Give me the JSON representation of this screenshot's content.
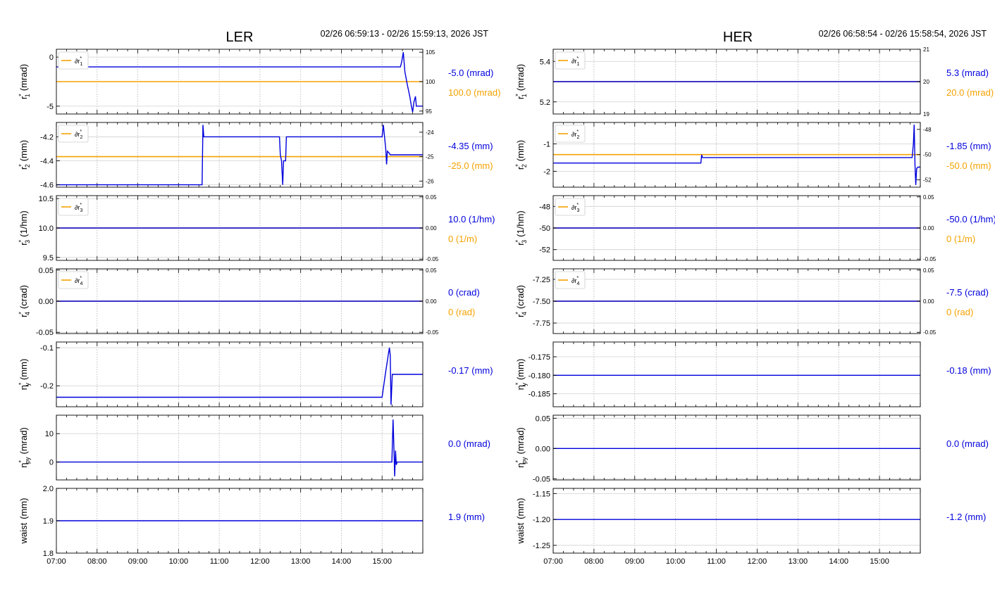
{
  "colors": {
    "blue": "#0000dd",
    "orange": "#f5a200",
    "grid": "#b0b0b0",
    "frame": "#000000"
  },
  "x_ticks": [
    "07:00",
    "08:00",
    "09:00",
    "10:00",
    "11:00",
    "12:00",
    "13:00",
    "14:00",
    "15:00"
  ],
  "panels": [
    {
      "title": "LER",
      "time_range": "02/26 06:59:13 - 02/26 15:59:13, 2026 JST",
      "rows": [
        {
          "ylabel_main": "r",
          "ylabel_sub": "1",
          "ylabel_unit": "(mrad)",
          "left_ticks": [
            "0",
            "-5"
          ],
          "left_tick_values": [
            0,
            -5
          ],
          "left_ylim": [
            -5.8,
            0.8
          ],
          "right_ticks": [
            "105",
            "100",
            "95"
          ],
          "right_tick_values": [
            105,
            100,
            95
          ],
          "right_ylim": [
            94.5,
            105.5
          ],
          "legend": {
            "label": "∂r",
            "sub": "1"
          },
          "value_blue": "-5.0 (mrad)",
          "value_orange": "100.0 (mrad)",
          "blue_series": [
            [
              7.0,
              -1.0
            ],
            [
              15.45,
              -1.0
            ],
            [
              15.48,
              -0.5
            ],
            [
              15.52,
              0.5
            ],
            [
              15.56,
              -1.5
            ],
            [
              15.62,
              -2.8
            ],
            [
              15.68,
              -4.0
            ],
            [
              15.72,
              -5.0
            ],
            [
              15.75,
              -5.6
            ],
            [
              15.78,
              -4.6
            ],
            [
              15.82,
              -4.0
            ],
            [
              15.84,
              -5.0
            ],
            [
              16.0,
              -5.0
            ]
          ],
          "orange_series": [
            [
              7.0,
              100.0
            ],
            [
              16.0,
              100.0
            ]
          ]
        },
        {
          "ylabel_main": "r",
          "ylabel_sub": "2",
          "ylabel_unit": "(mm)",
          "left_ticks": [
            "-4.2",
            "-4.4",
            "-4.6"
          ],
          "left_tick_values": [
            -4.2,
            -4.4,
            -4.6
          ],
          "left_ylim": [
            -4.62,
            -4.08
          ],
          "right_ticks": [
            "-24",
            "-25",
            "-26"
          ],
          "right_tick_values": [
            -24,
            -25,
            -26
          ],
          "right_ylim": [
            -26.25,
            -23.6
          ],
          "legend": {
            "label": "∂r",
            "sub": "2"
          },
          "value_blue": "-4.35 (mm)",
          "value_orange": "-25.0 (mm)",
          "blue_series": [
            [
              7.0,
              -4.6
            ],
            [
              10.58,
              -4.6
            ],
            [
              10.6,
              -4.1
            ],
            [
              10.62,
              -4.2
            ],
            [
              12.48,
              -4.2
            ],
            [
              12.5,
              -4.35
            ],
            [
              12.53,
              -4.4
            ],
            [
              12.56,
              -4.6
            ],
            [
              12.58,
              -4.4
            ],
            [
              12.63,
              -4.4
            ],
            [
              12.65,
              -4.2
            ],
            [
              15.0,
              -4.2
            ],
            [
              15.03,
              -4.1
            ],
            [
              15.06,
              -4.2
            ],
            [
              15.09,
              -4.3
            ],
            [
              15.11,
              -4.43
            ],
            [
              15.13,
              -4.32
            ],
            [
              15.16,
              -4.33
            ],
            [
              15.2,
              -4.35
            ],
            [
              16.0,
              -4.35
            ]
          ],
          "orange_series": [
            [
              7.0,
              -25.0
            ],
            [
              16.0,
              -25.0
            ]
          ]
        },
        {
          "ylabel_main": "r",
          "ylabel_sub": "3",
          "ylabel_unit": "(1/hm)",
          "left_ticks": [
            "10.5",
            "10.0",
            "9.5"
          ],
          "left_tick_values": [
            10.5,
            10.0,
            9.5
          ],
          "left_ylim": [
            9.45,
            10.55
          ],
          "right_ticks": [
            "0.05",
            "0.00",
            "-0.05"
          ],
          "right_tick_values": [
            0.05,
            0,
            -0.05
          ],
          "right_ylim": [
            -0.052,
            0.052
          ],
          "legend": {
            "label": "∂r",
            "sub": "3"
          },
          "value_blue": "10.0 (1/hm)",
          "value_orange": "0 (1/m)",
          "blue_series": [
            [
              7.0,
              10.0
            ],
            [
              16.0,
              10.0
            ]
          ],
          "orange_series": [
            [
              7.0,
              0.0
            ],
            [
              16.0,
              0.0
            ]
          ]
        },
        {
          "ylabel_main": "r",
          "ylabel_sub": "4",
          "ylabel_unit": "(crad)",
          "left_ticks": [
            "0.05",
            "0.00",
            "-0.05"
          ],
          "left_tick_values": [
            0.05,
            0,
            -0.05
          ],
          "left_ylim": [
            -0.052,
            0.052
          ],
          "right_ticks": [
            "0.05",
            "0.00",
            "-0.05"
          ],
          "right_tick_values": [
            0.05,
            0,
            -0.05
          ],
          "right_ylim": [
            -0.052,
            0.052
          ],
          "legend": {
            "label": "∂r",
            "sub": "4"
          },
          "value_blue": "0 (crad)",
          "value_orange": "0 (rad)",
          "blue_series": [
            [
              7.0,
              0.0
            ],
            [
              16.0,
              0.0
            ]
          ],
          "orange_series": [
            [
              7.0,
              0.0
            ],
            [
              16.0,
              0.0
            ]
          ]
        },
        {
          "ylabel_main": "η",
          "ylabel_sub": "y",
          "ylabel_unit": "(mm)",
          "left_ticks": [
            "-0.1",
            "-0.2"
          ],
          "left_tick_values": [
            -0.1,
            -0.2
          ],
          "left_ylim": [
            -0.255,
            -0.085
          ],
          "right_ticks": [],
          "right_tick_values": [],
          "right_ylim": null,
          "legend": null,
          "value_blue": "-0.17 (mm)",
          "value_orange": "",
          "blue_series": [
            [
              7.0,
              -0.23
            ],
            [
              15.0,
              -0.23
            ],
            [
              15.08,
              -0.17
            ],
            [
              15.15,
              -0.12
            ],
            [
              15.18,
              -0.1
            ],
            [
              15.2,
              -0.12
            ],
            [
              15.22,
              -0.25
            ],
            [
              15.25,
              -0.17
            ],
            [
              16.0,
              -0.17
            ]
          ],
          "orange_series": []
        },
        {
          "ylabel_main": "η",
          "ylabel_sub": "py",
          "ylabel_unit": "(mrad)",
          "left_ticks": [
            "10",
            "0"
          ],
          "left_tick_values": [
            10,
            0
          ],
          "left_ylim": [
            -6.3,
            16.5
          ],
          "right_ticks": [],
          "right_tick_values": [],
          "right_ylim": null,
          "legend": null,
          "value_blue": "0.0 (mrad)",
          "value_orange": "",
          "blue_series": [
            [
              7.0,
              0.0
            ],
            [
              15.24,
              0.0
            ],
            [
              15.27,
              15.0
            ],
            [
              15.29,
              5.0
            ],
            [
              15.31,
              -5.0
            ],
            [
              15.33,
              4.0
            ],
            [
              15.35,
              -1.0
            ],
            [
              15.37,
              0.0
            ],
            [
              16.0,
              0.0
            ]
          ],
          "orange_series": []
        },
        {
          "ylabel_main": "waist",
          "ylabel_sub": "",
          "ylabel_unit": "(mm)",
          "left_ticks": [
            "2.0",
            "1.9",
            "1.8"
          ],
          "left_tick_values": [
            2.0,
            1.9,
            1.8
          ],
          "left_ylim": [
            1.8,
            2.0
          ],
          "right_ticks": [],
          "right_tick_values": [],
          "right_ylim": null,
          "legend": null,
          "value_blue": "1.9 (mm)",
          "value_orange": "",
          "blue_series": [
            [
              7.0,
              1.9
            ],
            [
              16.0,
              1.9
            ]
          ],
          "orange_series": []
        }
      ]
    },
    {
      "title": "HER",
      "time_range": "02/26 06:58:54 - 02/26 15:58:54, 2026 JST",
      "rows": [
        {
          "ylabel_main": "r",
          "ylabel_sub": "1",
          "ylabel_unit": "(mrad)",
          "left_ticks": [
            "5.4",
            "5.2"
          ],
          "left_tick_values": [
            5.4,
            5.2
          ],
          "left_ylim": [
            5.14,
            5.46
          ],
          "right_ticks": [
            "21",
            "20",
            "19"
          ],
          "right_tick_values": [
            21,
            20,
            19
          ],
          "right_ylim": [
            19,
            21
          ],
          "legend": {
            "label": "∂r",
            "sub": "1"
          },
          "value_blue": "5.3 (mrad)",
          "value_orange": "20.0 (mrad)",
          "blue_series": [
            [
              7.0,
              5.3
            ],
            [
              16.0,
              5.3
            ]
          ],
          "orange_series": [
            [
              7.0,
              20.0
            ],
            [
              16.0,
              20.0
            ]
          ]
        },
        {
          "ylabel_main": "r",
          "ylabel_sub": "2",
          "ylabel_unit": "(mm)",
          "left_ticks": [
            "-1",
            "-2"
          ],
          "left_tick_values": [
            -1,
            -2
          ],
          "left_ylim": [
            -2.58,
            -0.22
          ],
          "right_ticks": [
            "-48",
            "-50",
            "-52"
          ],
          "right_tick_values": [
            -48,
            -50,
            -52
          ],
          "right_ylim": [
            -52.58,
            -47.45
          ],
          "legend": {
            "label": "∂r",
            "sub": "2"
          },
          "value_blue": "-1.85 (mm)",
          "value_orange": "-50.0 (mm)",
          "blue_series": [
            [
              7.0,
              -1.7
            ],
            [
              10.62,
              -1.7
            ],
            [
              10.64,
              -1.4
            ],
            [
              10.66,
              -1.5
            ],
            [
              15.8,
              -1.5
            ],
            [
              15.83,
              -1.0
            ],
            [
              15.85,
              -0.3
            ],
            [
              15.87,
              -1.8
            ],
            [
              15.89,
              -2.5
            ],
            [
              15.91,
              -1.9
            ],
            [
              15.94,
              -1.85
            ],
            [
              16.0,
              -1.85
            ]
          ],
          "orange_series": [
            [
              7.0,
              -50.0
            ],
            [
              16.0,
              -50.0
            ]
          ]
        },
        {
          "ylabel_main": "r",
          "ylabel_sub": "3",
          "ylabel_unit": "(1/hm)",
          "left_ticks": [
            "-48",
            "-50",
            "-52"
          ],
          "left_tick_values": [
            -48,
            -50,
            -52
          ],
          "left_ylim": [
            -53,
            -47
          ],
          "right_ticks": [
            "0.05",
            "0.00",
            "-0.05"
          ],
          "right_tick_values": [
            0.05,
            0,
            -0.05
          ],
          "right_ylim": [
            -0.052,
            0.052
          ],
          "legend": {
            "label": "∂r",
            "sub": "3"
          },
          "value_blue": "-50.0 (1/hm)",
          "value_orange": "0 (1/m)",
          "blue_series": [
            [
              7.0,
              -50.0
            ],
            [
              16.0,
              -50.0
            ]
          ],
          "orange_series": [
            [
              7.0,
              0.0
            ],
            [
              16.0,
              0.0
            ]
          ]
        },
        {
          "ylabel_main": "r",
          "ylabel_sub": "4",
          "ylabel_unit": "(crad)",
          "left_ticks": [
            "-7.25",
            "-7.50",
            "-7.75"
          ],
          "left_tick_values": [
            -7.25,
            -7.5,
            -7.75
          ],
          "left_ylim": [
            -7.87,
            -7.13
          ],
          "right_ticks": [
            "0.05",
            "0.00",
            "-0.05"
          ],
          "right_tick_values": [
            0.05,
            0,
            -0.05
          ],
          "right_ylim": [
            -0.052,
            0.052
          ],
          "legend": {
            "label": "∂r",
            "sub": "4"
          },
          "value_blue": "-7.5 (crad)",
          "value_orange": "0 (rad)",
          "blue_series": [
            [
              7.0,
              -7.5
            ],
            [
              16.0,
              -7.5
            ]
          ],
          "orange_series": [
            [
              7.0,
              0.0
            ],
            [
              16.0,
              0.0
            ]
          ]
        },
        {
          "ylabel_main": "η",
          "ylabel_sub": "y",
          "ylabel_unit": "(mm)",
          "left_ticks": [
            "-0.175",
            "-0.180",
            "-0.185"
          ],
          "left_tick_values": [
            -0.175,
            -0.18,
            -0.185
          ],
          "left_ylim": [
            -0.1885,
            -0.171
          ],
          "right_ticks": [],
          "right_tick_values": [],
          "right_ylim": null,
          "legend": null,
          "value_blue": "-0.18 (mm)",
          "value_orange": "",
          "blue_series": [
            [
              7.0,
              -0.18
            ],
            [
              16.0,
              -0.18
            ]
          ],
          "orange_series": []
        },
        {
          "ylabel_main": "η",
          "ylabel_sub": "py",
          "ylabel_unit": "(mrad)",
          "left_ticks": [
            "0.05",
            "0.00",
            "-0.05"
          ],
          "left_tick_values": [
            0.05,
            0,
            -0.05
          ],
          "left_ylim": [
            -0.052,
            0.055
          ],
          "right_ticks": [],
          "right_tick_values": [],
          "right_ylim": null,
          "legend": null,
          "value_blue": "0.0 (mrad)",
          "value_orange": "",
          "blue_series": [
            [
              7.0,
              0.0
            ],
            [
              16.0,
              0.0
            ]
          ],
          "orange_series": []
        },
        {
          "ylabel_main": "waist",
          "ylabel_sub": "",
          "ylabel_unit": "(mm)",
          "left_ticks": [
            "-1.15",
            "-1.20",
            "-1.25"
          ],
          "left_tick_values": [
            -1.15,
            -1.2,
            -1.25
          ],
          "left_ylim": [
            -1.265,
            -1.14
          ],
          "right_ticks": [],
          "right_tick_values": [],
          "right_ylim": null,
          "legend": null,
          "value_blue": "-1.2 (mm)",
          "value_orange": "",
          "blue_series": [
            [
              7.0,
              -1.2
            ],
            [
              16.0,
              -1.2
            ]
          ],
          "orange_series": []
        }
      ]
    }
  ]
}
